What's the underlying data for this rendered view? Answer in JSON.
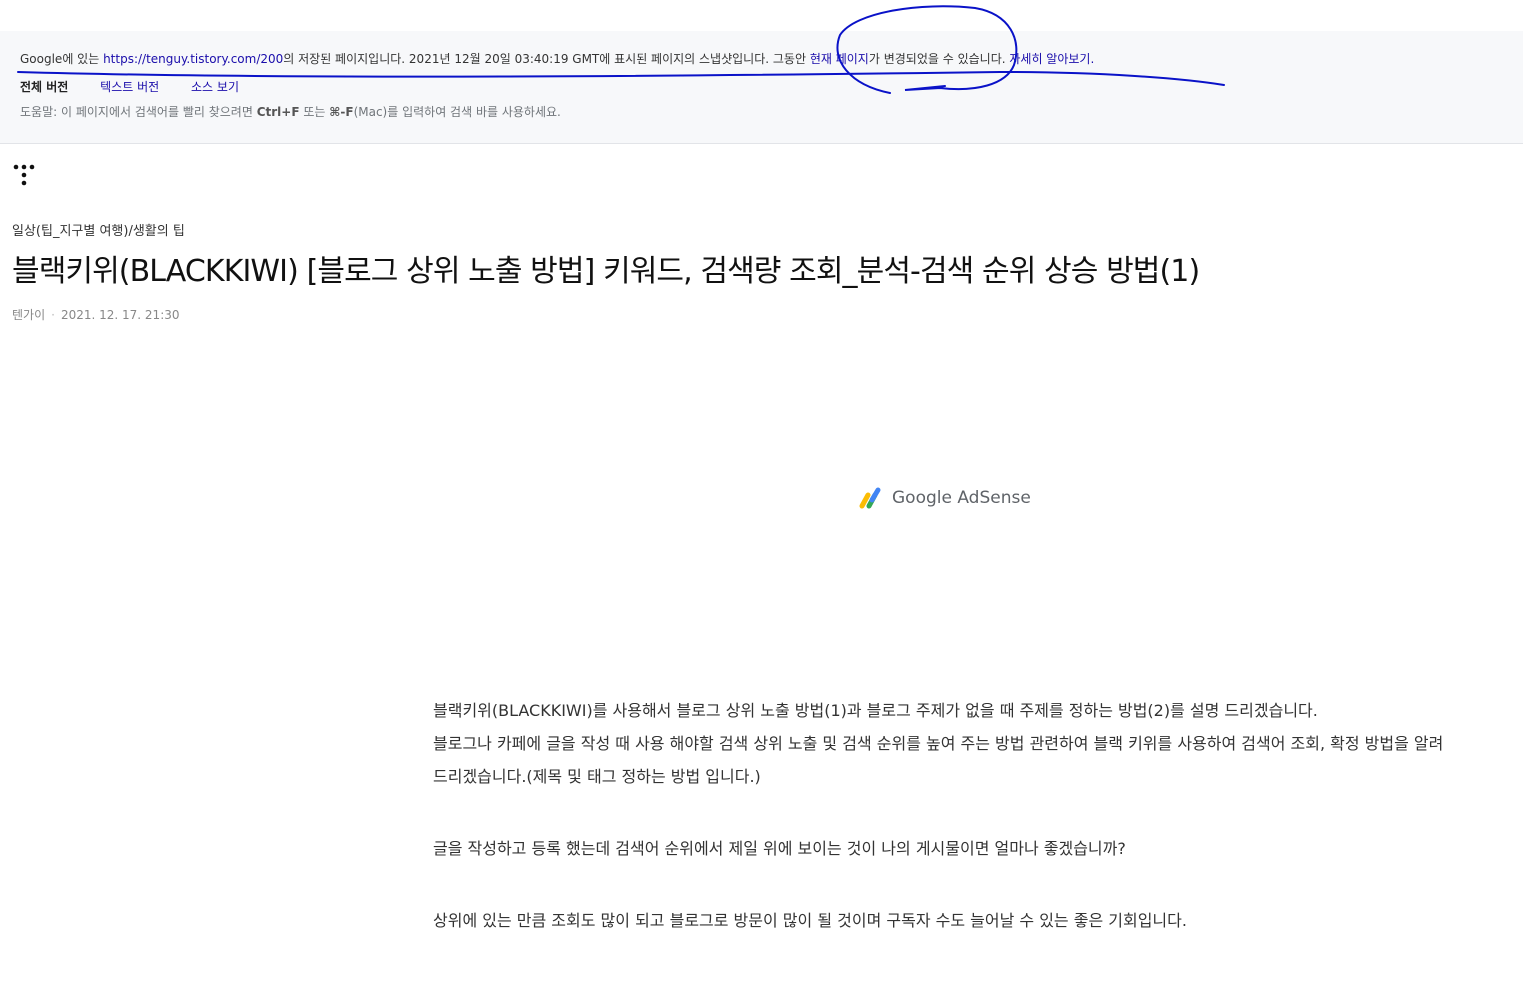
{
  "banner": {
    "prefix": "Google에 있는 ",
    "cached_url": "https://tenguy.tistory.com/200",
    "middle": "의 저장된 페이지입니다. 2021년 12월 20일 03:40:19 GMT에 표시된 페이지의 스냅샷입니다. 그동안 ",
    "current_page_link": "현재 페이지",
    "suffix": "가 변경되었을 수 있습니다. ",
    "learn_more_link": "자세히 알아보기.",
    "tabs": [
      "전체 버전",
      "텍스트 버전",
      "소스 보기"
    ],
    "help_prefix": "도움말: 이 페이지에서 검색어를 빨리 찾으려면 ",
    "help_shortcut_1": "Ctrl+F",
    "help_middle": " 또는 ",
    "help_shortcut_2": "⌘-F",
    "help_suffix": "(Mac)를 입력하여 검색 바를 사용하세요."
  },
  "post": {
    "category": "일상(팁_지구별 여행)/생활의 팁",
    "title": "블랙키위(BLACKKIWI) [블로그 상위 노출 방법] 키워드, 검색량 조회_분석-검색 순위 상승 방법(1)",
    "author": "텐가이",
    "separator": "·",
    "date": "2021. 12. 17. 21:30"
  },
  "ad": {
    "label": "Google AdSense",
    "colors": {
      "blue": "#4285f4",
      "green": "#34a853",
      "yellow": "#fbbc04"
    }
  },
  "content": {
    "paragraphs": [
      "블랙키위(BLACKKIWI)를 사용해서 블로그 상위 노출 방법(1)과 블로그 주제가 없을 때 주제를 정하는 방법(2)를 설명 드리겠습니다.",
      "블로그나 카페에 글을 작성 때 사용 해야할 검색 상위 노출 및 검색 순위를 높여 주는 방법 관련하여 블랙 키위를 사용하여 검색어 조회, 확정 방법을 알려 드리겠습니다.(제목 및 태그 정하는 방법 입니다.)",
      "글을 작성하고 등록 했는데 검색어 순위에서 제일 위에 보이는 것이 나의 게시물이면 얼마나 좋겠습니까?",
      "상위에 있는 만큼 조회도 많이 되고 블로그로 방문이 많이 될 것이며 구독자 수도 늘어날 수 있는 좋은 기회입니다."
    ]
  },
  "annotation_color": "#0a12c8"
}
